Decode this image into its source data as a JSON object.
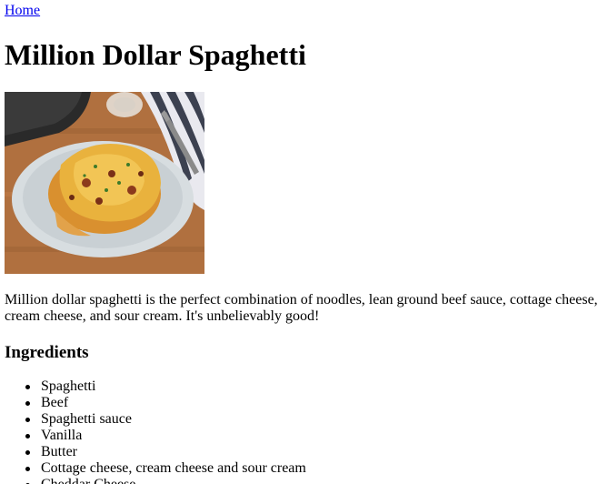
{
  "nav": {
    "home_label": "Home"
  },
  "recipe": {
    "title": "Million Dollar Spaghetti",
    "image_icon": "spaghetti-casserole-photo",
    "description": "Million dollar spaghetti is the perfect combination of noodles, lean ground beef sauce, cottage cheese, cream cheese, and sour cream. It's unbelievably good!",
    "ingredients_heading": "Ingredients",
    "ingredients": [
      "Spaghetti",
      "Beef",
      "Spaghetti sauce",
      "Vanilla",
      "Butter",
      "Cottage cheese, cream cheese and sour cream",
      "Cheddar Cheese"
    ]
  },
  "colors": {
    "link": "#0000ee",
    "text": "#000000",
    "background": "#ffffff"
  }
}
